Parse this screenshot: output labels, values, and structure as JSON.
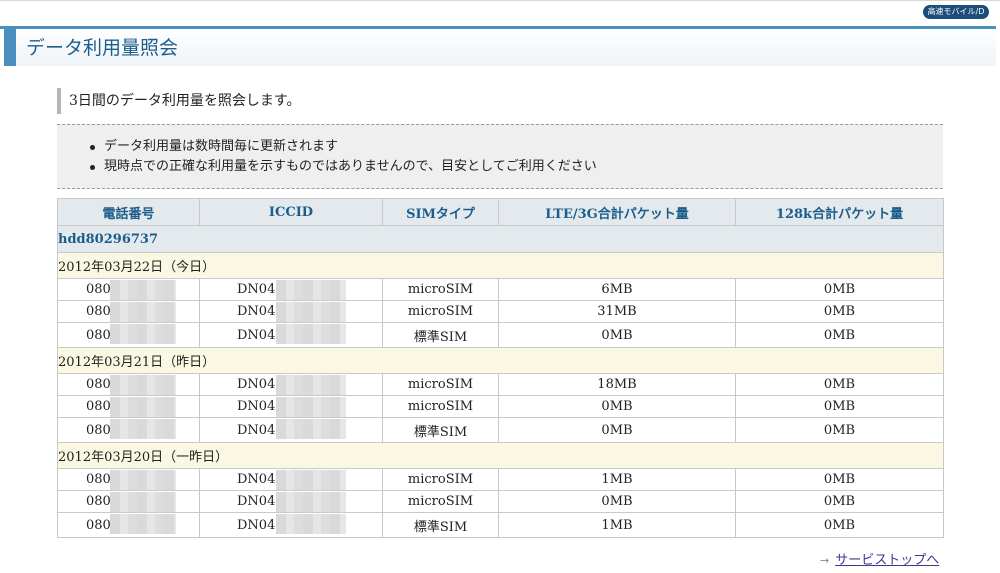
{
  "badge_label": "高速モバイル/D",
  "page_title": "データ利用量照会",
  "intro": "3日間のデータ利用量を照会します。",
  "notes": [
    "データ利用量は数時間毎に更新されます",
    "現時点での正確な利用量を示すものではありませんので、目安としてご利用ください"
  ],
  "table": {
    "headers": [
      "電話番号",
      "ICCID",
      "SIMタイプ",
      "LTE/3G合計パケット量",
      "128k合計パケット量"
    ],
    "user_id": "hdd80296737",
    "groups": [
      {
        "date": "2012年03月22日（今日）",
        "rows": [
          {
            "tel": "080-",
            "iccid": "DN040",
            "sim": "microSIM",
            "lte": "6MB",
            "k128": "0MB"
          },
          {
            "tel": "080-",
            "iccid": "DN040",
            "sim": "microSIM",
            "lte": "31MB",
            "k128": "0MB"
          },
          {
            "tel": "080-",
            "iccid": "DN040",
            "sim": "標準SIM",
            "lte": "0MB",
            "k128": "0MB"
          }
        ]
      },
      {
        "date": "2012年03月21日（昨日）",
        "rows": [
          {
            "tel": "080",
            "iccid": "DN040",
            "sim": "microSIM",
            "lte": "18MB",
            "k128": "0MB"
          },
          {
            "tel": "080",
            "iccid": "DN040",
            "sim": "microSIM",
            "lte": "0MB",
            "k128": "0MB"
          },
          {
            "tel": "080",
            "iccid": "DN040",
            "sim": "標準SIM",
            "lte": "0MB",
            "k128": "0MB"
          }
        ]
      },
      {
        "date": "2012年03月20日（一昨日）",
        "rows": [
          {
            "tel": "080-",
            "iccid": "DN040",
            "sim": "microSIM",
            "lte": "1MB",
            "k128": "0MB"
          },
          {
            "tel": "080-",
            "iccid": "DN040",
            "sim": "microSIM",
            "lte": "0MB",
            "k128": "0MB"
          },
          {
            "tel": "080-",
            "iccid": "DN040",
            "sim": "標準SIM",
            "lte": "1MB",
            "k128": "0MB"
          }
        ]
      }
    ]
  },
  "footer_link": "サービストップへ",
  "colors": {
    "accent": "#4b8fbf",
    "title_text": "#1b5e8c",
    "header_bg": "#e3e9ed",
    "date_row_bg": "#faf8e2",
    "badge_bg": "#1d4d7a"
  }
}
